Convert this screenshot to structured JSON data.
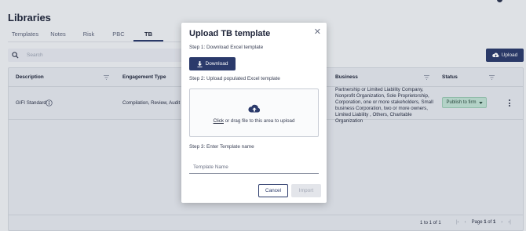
{
  "page": {
    "title": "Libraries"
  },
  "tabs": [
    {
      "label": "Templates"
    },
    {
      "label": "Notes"
    },
    {
      "label": "Risk"
    },
    {
      "label": "PBC"
    },
    {
      "label": "TB"
    }
  ],
  "search": {
    "placeholder": "Search"
  },
  "toolbar": {
    "upload_label": "Upload"
  },
  "table": {
    "columns": [
      "Description",
      "Engagement Type",
      "Business",
      "Status"
    ],
    "rows": [
      {
        "description": "GIFI Standard",
        "engagement_type": "Compilation, Review, Audit",
        "business": "Partnership or Limited Liability Company, Nonprofit Organization, Sole Proprietorship, Corporation, one or more stakeholders, Small business Corporation, two or more owners, Limited Liability , Others, Charitable Organization",
        "status": "Publish to firm"
      }
    ],
    "footer": {
      "range": "1 to 1 of 1",
      "page_label": "Page",
      "page_current": "1",
      "page_of": "of",
      "page_total": "1"
    }
  },
  "modal": {
    "title": "Upload TB template",
    "step1": "Step 1: Download Excel template",
    "download_label": "Download",
    "step2": "Step 2: Upload populated Excel template",
    "drop_click": "Click",
    "drop_rest": "or drag file to this area to upload",
    "step3": "Step 3: Enter Template name",
    "template_name_placeholder": "Template Name",
    "cancel_label": "Cancel",
    "import_label": "Import",
    "close_glyph": "✕"
  },
  "colors": {
    "primary": "#2b3a6b",
    "status_bg": "#bfe0d3",
    "background": "#eef0f4"
  },
  "icons": [
    "search-icon",
    "cloud-upload-icon",
    "filter-icon",
    "info-icon",
    "chevron-down-icon",
    "kebab-icon",
    "download-icon",
    "close-icon",
    "first-page-icon",
    "prev-page-icon",
    "next-page-icon",
    "last-page-icon"
  ]
}
